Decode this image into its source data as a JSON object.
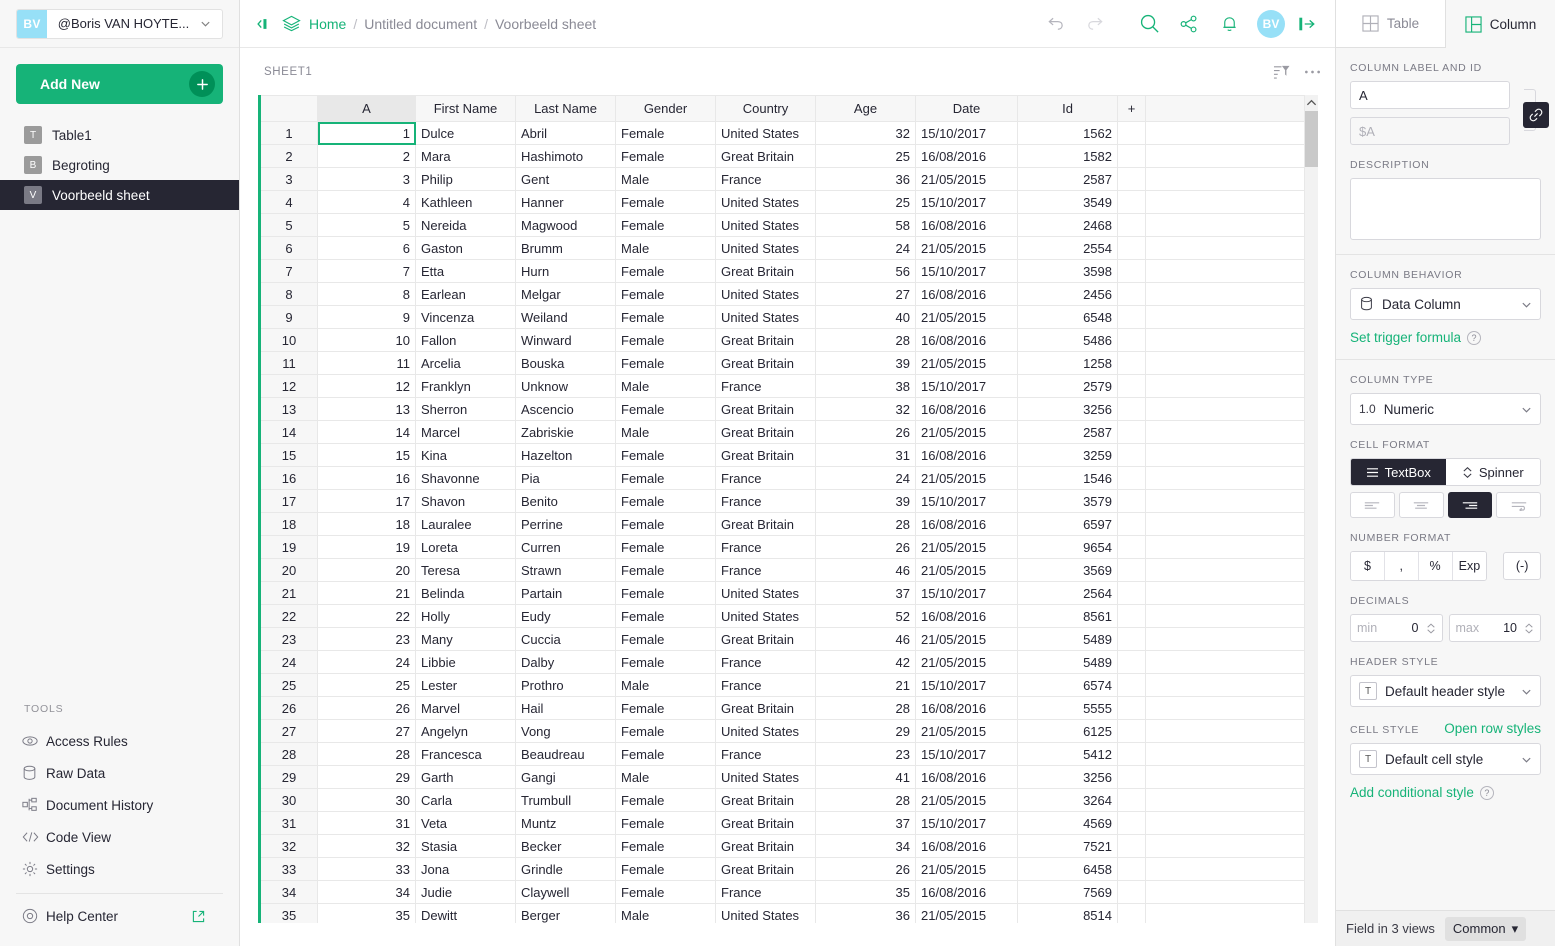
{
  "sidebar": {
    "account": {
      "initials": "BV",
      "name": "@Boris VAN HOYTE...",
      "caret": "chevron-down-icon"
    },
    "add_new_label": "Add New",
    "pages": [
      {
        "badge": "T",
        "label": "Table1",
        "selected": false
      },
      {
        "badge": "B",
        "label": "Begroting",
        "selected": false
      },
      {
        "badge": "V",
        "label": "Voorbeeld sheet",
        "selected": true
      }
    ],
    "tools_header": "TOOLS",
    "tools": [
      {
        "icon": "eye-icon",
        "label": "Access Rules"
      },
      {
        "icon": "database-icon",
        "label": "Raw Data"
      },
      {
        "icon": "history-icon",
        "label": "Document History"
      },
      {
        "icon": "code-icon",
        "label": "Code View"
      },
      {
        "icon": "gear-icon",
        "label": "Settings"
      }
    ],
    "help": {
      "icon": "help-icon",
      "label": "Help Center",
      "external_icon": "external-link-icon"
    }
  },
  "topbar": {
    "collapse_icon": "collapse-panel-icon",
    "doc_icon": "layers-icon",
    "breadcrumb": {
      "home": "Home",
      "sep": "/",
      "document": "Untitled document",
      "page": "Voorbeeld sheet"
    },
    "actions": [
      {
        "name": "undo-button",
        "icon": "undo-icon"
      },
      {
        "name": "redo-button",
        "icon": "redo-icon"
      },
      {
        "name": "search-button",
        "icon": "search-icon"
      },
      {
        "name": "share-button",
        "icon": "share-icon"
      },
      {
        "name": "notifications-button",
        "icon": "bell-icon"
      }
    ],
    "avatar": "BV",
    "signout_icon": "sign-out-icon"
  },
  "sheet": {
    "label": "SHEET1",
    "filter_icon": "sort-filter-icon",
    "more_icon": "more-options-icon",
    "add_column_label": "+",
    "selected_cell": {
      "row": 1,
      "column": "A",
      "value": "1"
    },
    "columns": [
      "A",
      "First Name",
      "Last Name",
      "Gender",
      "Country",
      "Age",
      "Date",
      "Id"
    ],
    "column_aligns": [
      "num",
      "txt",
      "txt",
      "txt",
      "txt",
      "num",
      "txt",
      "num"
    ],
    "rows": [
      [
        "1",
        "Dulce",
        "Abril",
        "Female",
        "United States",
        "32",
        "15/10/2017",
        "1562"
      ],
      [
        "2",
        "Mara",
        "Hashimoto",
        "Female",
        "Great Britain",
        "25",
        "16/08/2016",
        "1582"
      ],
      [
        "3",
        "Philip",
        "Gent",
        "Male",
        "France",
        "36",
        "21/05/2015",
        "2587"
      ],
      [
        "4",
        "Kathleen",
        "Hanner",
        "Female",
        "United States",
        "25",
        "15/10/2017",
        "3549"
      ],
      [
        "5",
        "Nereida",
        "Magwood",
        "Female",
        "United States",
        "58",
        "16/08/2016",
        "2468"
      ],
      [
        "6",
        "Gaston",
        "Brumm",
        "Male",
        "United States",
        "24",
        "21/05/2015",
        "2554"
      ],
      [
        "7",
        "Etta",
        "Hurn",
        "Female",
        "Great Britain",
        "56",
        "15/10/2017",
        "3598"
      ],
      [
        "8",
        "Earlean",
        "Melgar",
        "Female",
        "United States",
        "27",
        "16/08/2016",
        "2456"
      ],
      [
        "9",
        "Vincenza",
        "Weiland",
        "Female",
        "United States",
        "40",
        "21/05/2015",
        "6548"
      ],
      [
        "10",
        "Fallon",
        "Winward",
        "Female",
        "Great Britain",
        "28",
        "16/08/2016",
        "5486"
      ],
      [
        "11",
        "Arcelia",
        "Bouska",
        "Female",
        "Great Britain",
        "39",
        "21/05/2015",
        "1258"
      ],
      [
        "12",
        "Franklyn",
        "Unknow",
        "Male",
        "France",
        "38",
        "15/10/2017",
        "2579"
      ],
      [
        "13",
        "Sherron",
        "Ascencio",
        "Female",
        "Great Britain",
        "32",
        "16/08/2016",
        "3256"
      ],
      [
        "14",
        "Marcel",
        "Zabriskie",
        "Male",
        "Great Britain",
        "26",
        "21/05/2015",
        "2587"
      ],
      [
        "15",
        "Kina",
        "Hazelton",
        "Female",
        "Great Britain",
        "31",
        "16/08/2016",
        "3259"
      ],
      [
        "16",
        "Shavonne",
        "Pia",
        "Female",
        "France",
        "24",
        "21/05/2015",
        "1546"
      ],
      [
        "17",
        "Shavon",
        "Benito",
        "Female",
        "France",
        "39",
        "15/10/2017",
        "3579"
      ],
      [
        "18",
        "Lauralee",
        "Perrine",
        "Female",
        "Great Britain",
        "28",
        "16/08/2016",
        "6597"
      ],
      [
        "19",
        "Loreta",
        "Curren",
        "Female",
        "France",
        "26",
        "21/05/2015",
        "9654"
      ],
      [
        "20",
        "Teresa",
        "Strawn",
        "Female",
        "France",
        "46",
        "21/05/2015",
        "3569"
      ],
      [
        "21",
        "Belinda",
        "Partain",
        "Female",
        "United States",
        "37",
        "15/10/2017",
        "2564"
      ],
      [
        "22",
        "Holly",
        "Eudy",
        "Female",
        "United States",
        "52",
        "16/08/2016",
        "8561"
      ],
      [
        "23",
        "Many",
        "Cuccia",
        "Female",
        "Great Britain",
        "46",
        "21/05/2015",
        "5489"
      ],
      [
        "24",
        "Libbie",
        "Dalby",
        "Female",
        "France",
        "42",
        "21/05/2015",
        "5489"
      ],
      [
        "25",
        "Lester",
        "Prothro",
        "Male",
        "France",
        "21",
        "15/10/2017",
        "6574"
      ],
      [
        "26",
        "Marvel",
        "Hail",
        "Female",
        "Great Britain",
        "28",
        "16/08/2016",
        "5555"
      ],
      [
        "27",
        "Angelyn",
        "Vong",
        "Female",
        "United States",
        "29",
        "21/05/2015",
        "6125"
      ],
      [
        "28",
        "Francesca",
        "Beaudreau",
        "Female",
        "France",
        "23",
        "15/10/2017",
        "5412"
      ],
      [
        "29",
        "Garth",
        "Gangi",
        "Male",
        "United States",
        "41",
        "16/08/2016",
        "3256"
      ],
      [
        "30",
        "Carla",
        "Trumbull",
        "Female",
        "Great Britain",
        "28",
        "21/05/2015",
        "3264"
      ],
      [
        "31",
        "Veta",
        "Muntz",
        "Female",
        "Great Britain",
        "37",
        "15/10/2017",
        "4569"
      ],
      [
        "32",
        "Stasia",
        "Becker",
        "Female",
        "Great Britain",
        "34",
        "16/08/2016",
        "7521"
      ],
      [
        "33",
        "Jona",
        "Grindle",
        "Female",
        "Great Britain",
        "26",
        "21/05/2015",
        "6458"
      ],
      [
        "34",
        "Judie",
        "Claywell",
        "Female",
        "France",
        "35",
        "16/08/2016",
        "7569"
      ],
      [
        "35",
        "Dewitt",
        "Berger",
        "Male",
        "United States",
        "36",
        "21/05/2015",
        "8514"
      ]
    ]
  },
  "right_panel": {
    "tabs": [
      {
        "label": "Table",
        "icon": "table-icon",
        "active": false
      },
      {
        "label": "Column",
        "icon": "column-icon",
        "active": true
      }
    ],
    "column_label_section": "COLUMN LABEL AND ID",
    "column_label_value": "A",
    "column_id_placeholder": "$A",
    "link_icon": "link-icon",
    "description_section": "DESCRIPTION",
    "description_value": "",
    "column_behavior_section": "COLUMN BEHAVIOR",
    "column_behavior_value": "Data Column",
    "column_behavior_icon": "database-icon",
    "trigger_formula_link": "Set trigger formula",
    "column_type_section": "COLUMN TYPE",
    "column_type_value": "Numeric",
    "column_type_icon": "1.0",
    "cell_format_section": "CELL FORMAT",
    "cell_format": [
      {
        "label": "TextBox",
        "icon": "textbox-icon",
        "active": true
      },
      {
        "label": "Spinner",
        "icon": "spinner-icon",
        "active": false
      }
    ],
    "alignments": [
      {
        "name": "align-left",
        "active": false
      },
      {
        "name": "align-center",
        "active": false
      },
      {
        "name": "align-right",
        "active": true
      },
      {
        "name": "align-wrap",
        "active": false
      }
    ],
    "number_format_section": "NUMBER FORMAT",
    "number_formats": [
      "$",
      ",",
      "%",
      "Exp"
    ],
    "negative_format": "(-)",
    "decimals_section": "DECIMALS",
    "decimals_min_label": "min",
    "decimals_min_value": "0",
    "decimals_max_label": "max",
    "decimals_max_value": "10",
    "header_style_section": "HEADER STYLE",
    "header_style_value": "Default header style",
    "header_style_icon": "T",
    "cell_style_section": "CELL STYLE",
    "open_row_styles_link": "Open row styles",
    "cell_style_value": "Default cell style",
    "cell_style_icon": "T",
    "add_conditional_style_link": "Add conditional style",
    "footer_text": "Field in 3 views",
    "footer_select": "Common"
  },
  "colors": {
    "accent_green": "#16b378",
    "dark": "#262633",
    "avatar_blue": "#97e0f7"
  }
}
